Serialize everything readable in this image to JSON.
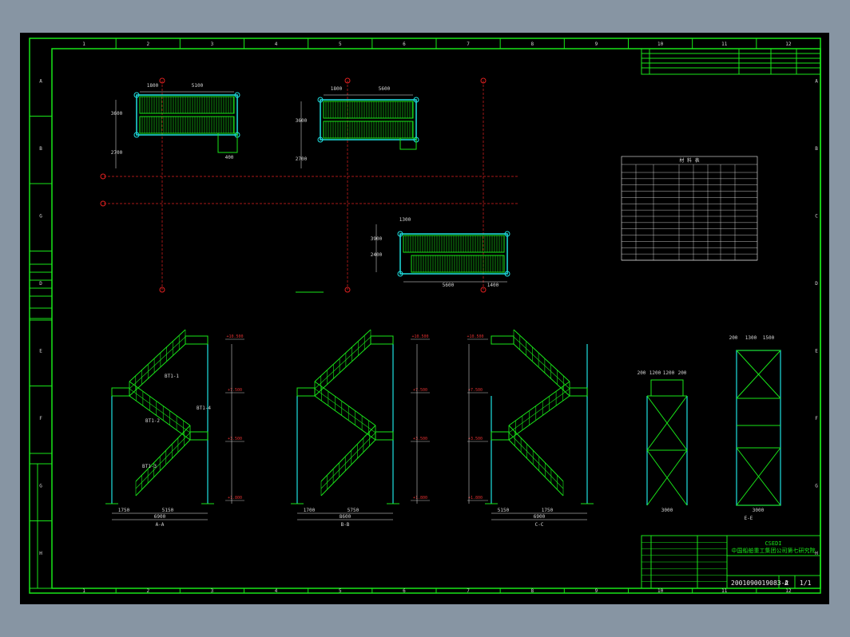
{
  "border": {
    "columns": [
      "1",
      "2",
      "3",
      "4",
      "5",
      "6",
      "7",
      "8",
      "9",
      "10",
      "11",
      "12"
    ],
    "rows_left": [
      "A",
      "B",
      "G",
      "D",
      "E",
      "F",
      "G",
      "H"
    ],
    "rows_right": [
      "A",
      "B",
      "C",
      "D",
      "E",
      "F",
      "G",
      "H"
    ]
  },
  "plans": {
    "top_left": {
      "dims": [
        "1800",
        "5100"
      ],
      "side": [
        "3600",
        "2700"
      ],
      "bottom": [
        "400"
      ]
    },
    "top_mid": {
      "dims": [
        "1800",
        "5600"
      ],
      "side": [
        "3600",
        "2700"
      ]
    },
    "bottom_mid": {
      "dims": [
        "1300",
        "5600",
        "1400"
      ],
      "side": [
        "3900",
        "2400"
      ]
    }
  },
  "elevations": {
    "levels_left": [
      "+10.500",
      "+7.500",
      "+3.500",
      "+1.800"
    ],
    "levels_mid": [
      "+10.500",
      "+7.500",
      "+3.500",
      "+1.800"
    ],
    "levels_right": [
      "+10.500",
      "+7.500",
      "+3.500",
      "+1.800"
    ],
    "ladder_labels": [
      "BT1-1",
      "BT1-2",
      "BT1-3",
      "BT1-4"
    ],
    "bottom_dims_left": [
      "1750",
      "5150",
      "6900"
    ],
    "bottom_dims_mid": [
      "1700",
      "5750",
      "8600"
    ],
    "bottom_dims_right": [
      "5150",
      "1750",
      "6900"
    ],
    "view_labels": [
      "A-A",
      "B-B",
      "C-C"
    ],
    "side_dims_top": [
      "200",
      "1200",
      "1200",
      "200"
    ],
    "side_dim_bottom": "3000",
    "tower_dims_top": [
      "200",
      "1300",
      "1500"
    ],
    "tower_dim_bottom": "3000",
    "tower_label": "E-E"
  },
  "table": {
    "title": "材  料  表",
    "rows": 14
  },
  "title_block": {
    "company": "CSEDI",
    "company_cn": "中国船舶重工集团公司第七研究院",
    "drawing_no": "2001090019083-2",
    "sheet": "1/1",
    "scale": "A"
  }
}
